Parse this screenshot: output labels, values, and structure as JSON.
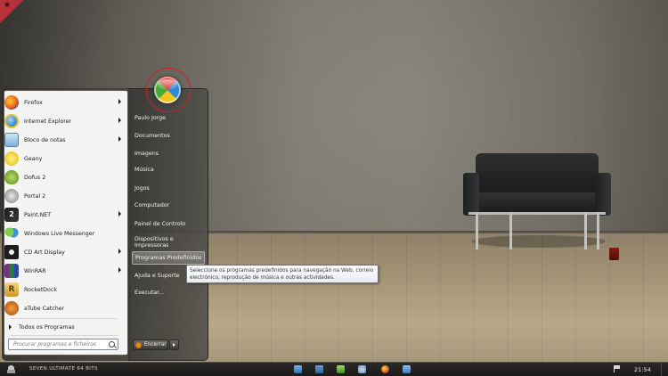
{
  "colors": {
    "accent_ring": "#d81e1e",
    "menu_left_bg": "#f4f4f2",
    "places_bg": "#4a4945",
    "taskbar_bg": "#1f1e1c"
  },
  "start_menu": {
    "programs": [
      {
        "label": "Firefox",
        "icon": "firefox-icon",
        "has_submenu": true
      },
      {
        "label": "Internet Explorer",
        "icon": "internet-explorer-icon",
        "has_submenu": true
      },
      {
        "label": "Bloco de notas",
        "icon": "notepad-icon",
        "has_submenu": true
      },
      {
        "label": "Geany",
        "icon": "geany-icon",
        "has_submenu": false
      },
      {
        "label": "Dofus 2",
        "icon": "dofus-icon",
        "has_submenu": false
      },
      {
        "label": "Portal 2",
        "icon": "portal-icon",
        "has_submenu": false
      },
      {
        "label": "Paint.NET",
        "icon": "paint-net-icon",
        "has_submenu": true
      },
      {
        "label": "Windows Live Messenger",
        "icon": "messenger-icon",
        "has_submenu": false
      },
      {
        "label": "CD Art Display",
        "icon": "cd-art-display-icon",
        "has_submenu": true
      },
      {
        "label": "WinRAR",
        "icon": "winrar-icon",
        "has_submenu": true
      },
      {
        "label": "RocketDock",
        "icon": "rocketdock-icon",
        "has_submenu": false
      },
      {
        "label": "aTube Catcher",
        "icon": "atube-catcher-icon",
        "has_submenu": false
      }
    ],
    "all_programs": "Todos os Programas",
    "search_placeholder": "Procurar programas e ficheiros",
    "places": [
      {
        "label": "Paulo Jorge"
      },
      {
        "label": "Documentos"
      },
      {
        "label": "Imagens"
      },
      {
        "label": "Música"
      },
      {
        "label": "Jogos"
      },
      {
        "label": "Computador"
      },
      {
        "label": "Painel de Controlo"
      },
      {
        "label": "Dispositivos e Impressoras"
      },
      {
        "label": "Programas Predefinidos"
      },
      {
        "label": "Ajuda e Suporte"
      },
      {
        "label": "Executar..."
      }
    ],
    "shutdown_label": "Encerrar"
  },
  "tooltip": {
    "text": "Seleccione os programas predefinidos para navegação na Web, correio electrónico, reprodução de música e outras actividades."
  },
  "taskbar": {
    "label": "SEVEN ULTIMATE 64 BITS",
    "clock": "21:54"
  }
}
